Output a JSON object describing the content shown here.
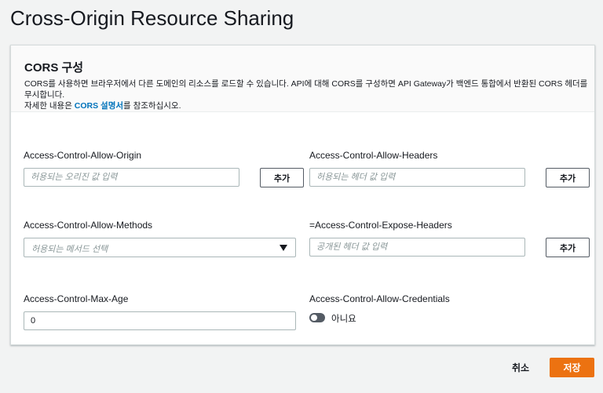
{
  "page": {
    "title": "Cross-Origin Resource Sharing"
  },
  "panel": {
    "title": "CORS 구성",
    "description_line1": "CORS를 사용하면 브라우저에서 다른 도메인의 리소스를 로드할 수 있습니다. API에 대해 CORS를 구성하면 API Gateway가 백엔드 통합에서 반환된 CORS 헤더를 무시합니다.",
    "description_line2_prefix": "자세한 내용은 ",
    "description_link": "CORS 설명서",
    "description_line2_suffix": "를 참조하십시오."
  },
  "fields": {
    "allow_origin": {
      "label": "Access-Control-Allow-Origin",
      "placeholder": "허용되는 오리진 값 입력",
      "value": "",
      "add_label": "추가"
    },
    "allow_headers": {
      "label": "Access-Control-Allow-Headers",
      "placeholder": "허용되는 헤더 값 입력",
      "value": "",
      "add_label": "추가"
    },
    "allow_methods": {
      "label": "Access-Control-Allow-Methods",
      "placeholder": "허용되는 메서드 선택"
    },
    "expose_headers": {
      "label": "=Access-Control-Expose-Headers",
      "placeholder": "공개된 헤더 값 입력",
      "value": "",
      "add_label": "추가"
    },
    "max_age": {
      "label": "Access-Control-Max-Age",
      "value": "0"
    },
    "allow_credentials": {
      "label": "Access-Control-Allow-Credentials",
      "toggle_text": "아니요",
      "enabled": false
    }
  },
  "footer": {
    "cancel_label": "취소",
    "save_label": "저장"
  },
  "colors": {
    "primary": "#ec7211",
    "link": "#0073bb",
    "toggle_off": "#545b64"
  },
  "icons": {
    "select_caret": "caret-down-icon"
  }
}
